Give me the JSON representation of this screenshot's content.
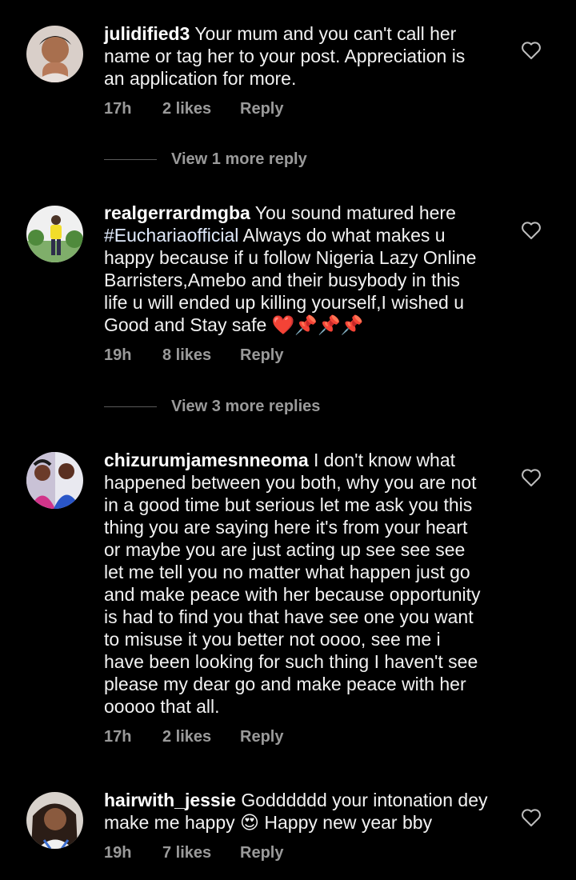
{
  "comments": [
    {
      "username": "julidified3",
      "text": "Your mum and you can't call her\nname or tag her to your post. Appreciation is\nan application for more.",
      "time": "17h",
      "likes": "2 likes",
      "reply_label": "Reply",
      "view_more": "View 1 more reply"
    },
    {
      "username": "realgerrardmgba",
      "text_before": "You sound matured here\n",
      "hashtag": "#Euchariaofficial",
      "text_after": " Always do what makes u\nhappy because if u follow Nigeria Lazy Online\nBarristers,Amebo and their busybody in this\nlife u will ended up killing yourself,I wished u\nGood and Stay safe ❤️📌📌📌",
      "time": "19h",
      "likes": "8 likes",
      "reply_label": "Reply",
      "view_more": "View 3 more replies"
    },
    {
      "username": "chizurumjamesnneoma",
      "text": "I don't know what\nhappened between you both, why you are not\nin a good time but serious let me ask you this\nthing you are saying here it's from your heart\nor maybe you are just acting up see see see\nlet me tell you no matter what happen just go\nand make peace with her because opportunity\nis had to find you that have see one you want\nto misuse it you better not oooo, see me i\nhave been looking for such thing I haven't see\nplease my dear go and make peace with her\nooooo that all.",
      "time": "17h",
      "likes": "2 likes",
      "reply_label": "Reply"
    },
    {
      "username": "hairwith_jessie",
      "text": "Godddddd your intonation dey\nmake me happy 😍 Happy new year bby",
      "time": "19h",
      "likes": "7 likes",
      "reply_label": "Reply"
    }
  ],
  "icons": {
    "like": "heart-outline-icon"
  },
  "colors": {
    "background": "#000000",
    "text": "#f2f2f2",
    "meta": "#9a9a9a"
  }
}
